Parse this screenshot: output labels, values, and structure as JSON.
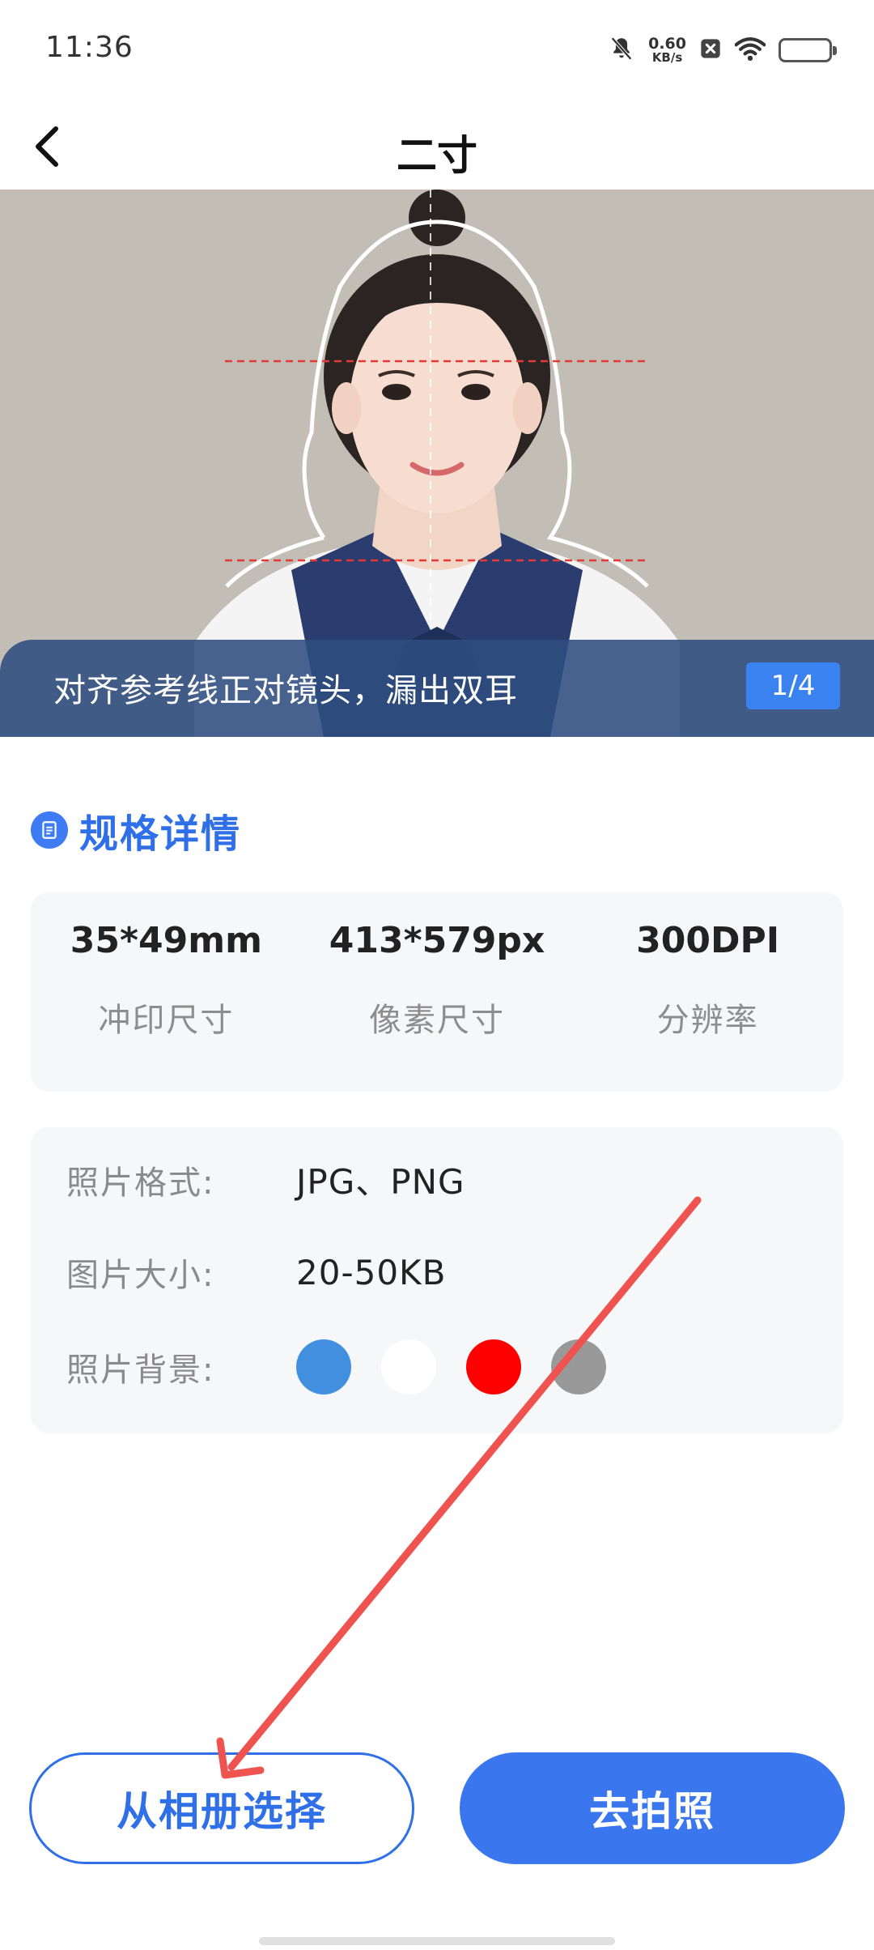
{
  "status_bar": {
    "time": "11:36",
    "net_speed_value": "0.60",
    "net_speed_unit": "KB/s",
    "icons": [
      "mute-bell-icon",
      "close-box-icon",
      "wifi-icon",
      "battery-icon"
    ]
  },
  "header": {
    "back_icon": "chevron-left-icon",
    "title": "二寸"
  },
  "preview": {
    "tip": "对齐参考线正对镜头，漏出双耳",
    "page_indicator": "1/4"
  },
  "specs": {
    "section_title": "规格详情",
    "items": [
      {
        "value": "35*49mm",
        "label": "冲印尺寸"
      },
      {
        "value": "413*579px",
        "label": "像素尺寸"
      },
      {
        "value": "300DPI",
        "label": "分辨率"
      }
    ]
  },
  "info": {
    "format_label": "照片格式:",
    "format_value": "JPG、PNG",
    "size_label": "图片大小:",
    "size_value": "20-50KB",
    "background_label": "照片背景:",
    "background_colors": [
      "#438fdf",
      "#ffffff",
      "#ff0000",
      "#999999"
    ]
  },
  "actions": {
    "album_button": "从相册选择",
    "camera_button": "去拍照"
  },
  "colors": {
    "accent": "#3a76ee",
    "tip_bar": "#2f4d81",
    "annotation_arrow": "#ef5350"
  }
}
